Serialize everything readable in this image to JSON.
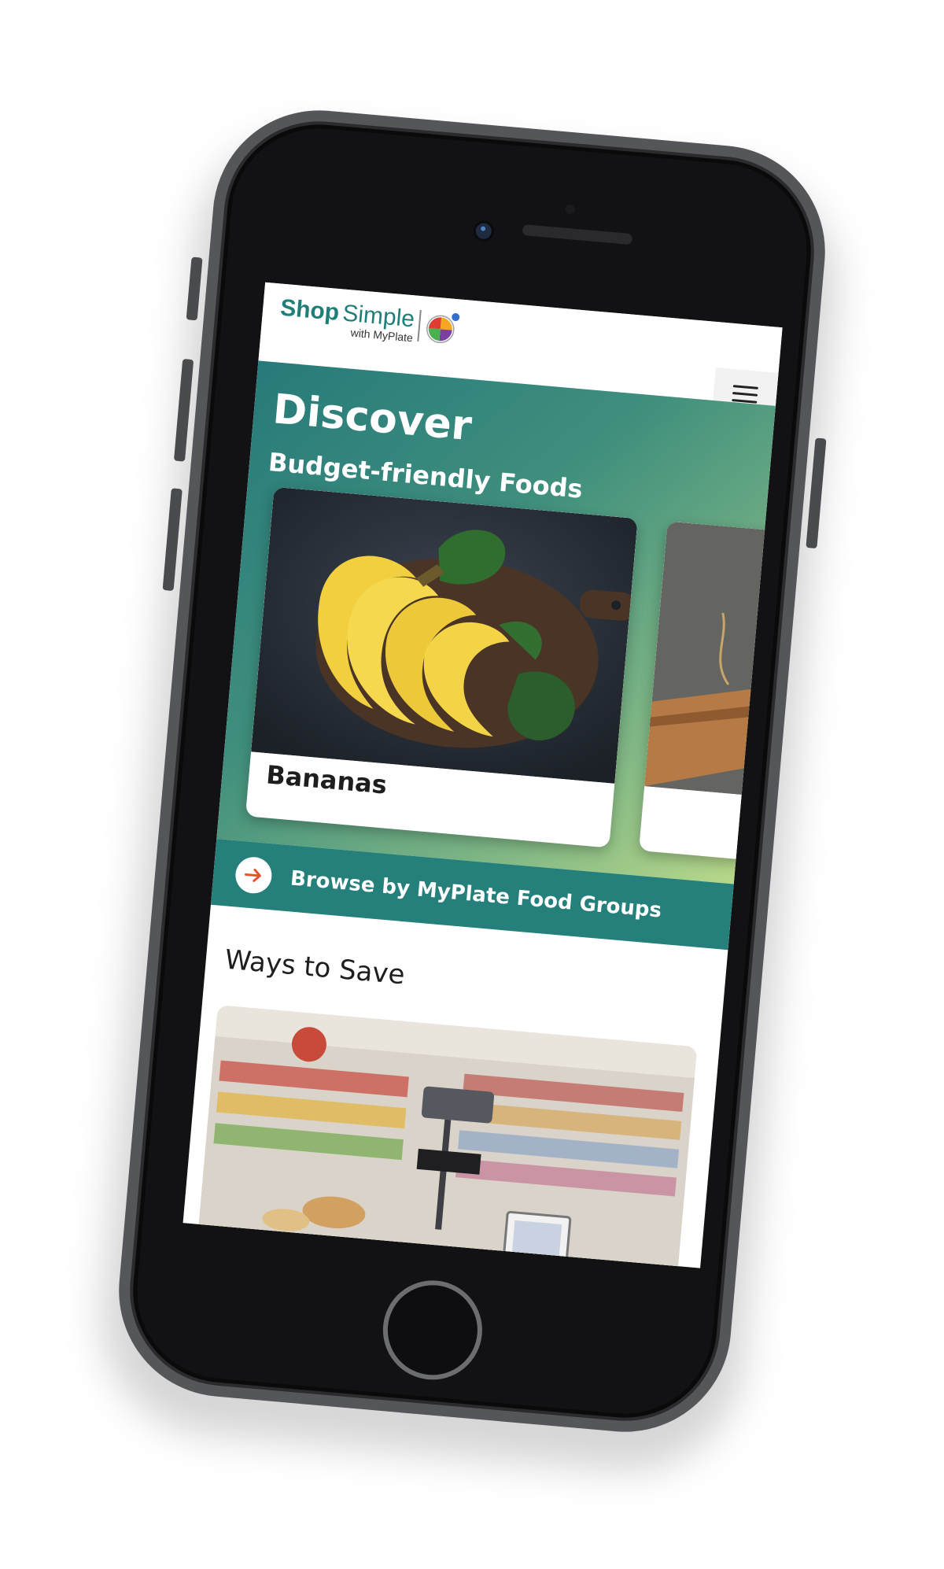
{
  "brand": {
    "name_bold": "Shop",
    "name_regular": "Simple",
    "subtitle": "with MyPlate",
    "plate_colors": [
      "#e03c31",
      "#f5a623",
      "#7b3fa0",
      "#4caf50",
      "#2f6fd1"
    ]
  },
  "header": {
    "menu_icon": "hamburger-icon"
  },
  "hero": {
    "title": "Discover",
    "subtitle": "Budget-friendly Foods",
    "cards": [
      {
        "label": "Bananas",
        "image": "bananas-on-cutting-board"
      },
      {
        "label": "",
        "image": "wood-board-partial"
      }
    ]
  },
  "browse": {
    "label": "Browse by MyPlate Food Groups",
    "icon": "arrow-right-circle-icon"
  },
  "ways_to_save": {
    "title": "Ways to Save",
    "image": "grocery-store-checkout"
  },
  "colors": {
    "brand_teal": "#1f7f78",
    "browse_bar": "#25807c",
    "arrow_accent": "#e8532f"
  }
}
